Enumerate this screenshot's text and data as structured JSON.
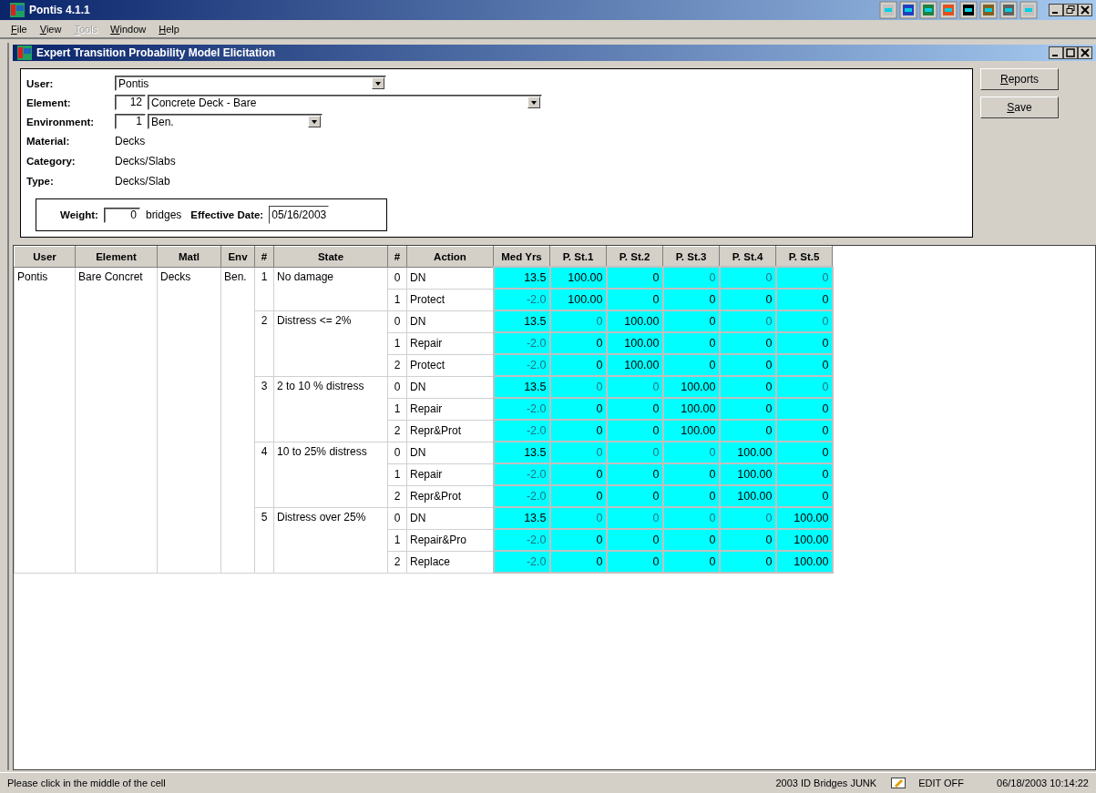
{
  "app": {
    "title": "Pontis 4.1.1"
  },
  "menu": [
    {
      "label": "File",
      "disabled": false
    },
    {
      "label": "View",
      "disabled": false
    },
    {
      "label": "Tools",
      "disabled": true
    },
    {
      "label": "Window",
      "disabled": false
    },
    {
      "label": "Help",
      "disabled": false
    }
  ],
  "child_window": {
    "title": "Expert Transition Probability Model Elicitation"
  },
  "form": {
    "user": {
      "label": "User:",
      "value": "Pontis"
    },
    "element": {
      "label": "Element:",
      "code": "12",
      "value": "Concrete Deck - Bare"
    },
    "environment": {
      "label": "Environment:",
      "code": "1",
      "value": "Ben."
    },
    "info": [
      {
        "label": "Material:",
        "value": "Decks"
      },
      {
        "label": "Category:",
        "value": "Decks/Slabs"
      },
      {
        "label": "Type:",
        "value": "Decks/Slab"
      }
    ],
    "weight": {
      "label": "Weight:",
      "value": "0",
      "unit": "bridges"
    },
    "effective_date": {
      "label": "Effective Date:",
      "value": "05/16/2003"
    }
  },
  "buttons": [
    "Reports",
    "Save"
  ],
  "grid": {
    "columns": [
      "User",
      "Element",
      "Matl",
      "Env",
      "#",
      "State",
      "#",
      "Action",
      "Med Yrs",
      "P. St.1",
      "P. St.2",
      "P. St.3",
      "P. St.4",
      "P. St.5"
    ],
    "user": "Pontis",
    "element": "Bare Concret",
    "matl": "Decks",
    "env": "Ben.",
    "states": [
      {
        "num": "1",
        "name": "No damage",
        "actions": [
          {
            "num": "0",
            "name": "DN",
            "med_yrs": {
              "text": "13.5",
              "dim": false
            },
            "probs": [
              {
                "text": "100.00",
                "dim": false
              },
              {
                "text": "0",
                "dim": false
              },
              {
                "text": "0",
                "dim": true
              },
              {
                "text": "0",
                "dim": true
              },
              {
                "text": "0",
                "dim": true
              }
            ]
          },
          {
            "num": "1",
            "name": "Protect",
            "med_yrs": {
              "text": "-2.0",
              "dim": true
            },
            "probs": [
              {
                "text": "100.00",
                "dim": false
              },
              {
                "text": "0",
                "dim": false
              },
              {
                "text": "0",
                "dim": false
              },
              {
                "text": "0",
                "dim": false
              },
              {
                "text": "0",
                "dim": false
              }
            ]
          }
        ]
      },
      {
        "num": "2",
        "name": "Distress <= 2%",
        "actions": [
          {
            "num": "0",
            "name": "DN",
            "med_yrs": {
              "text": "13.5",
              "dim": false
            },
            "probs": [
              {
                "text": "0",
                "dim": true
              },
              {
                "text": "100.00",
                "dim": false
              },
              {
                "text": "0",
                "dim": false
              },
              {
                "text": "0",
                "dim": true
              },
              {
                "text": "0",
                "dim": true
              }
            ]
          },
          {
            "num": "1",
            "name": "Repair",
            "med_yrs": {
              "text": "-2.0",
              "dim": true
            },
            "probs": [
              {
                "text": "0",
                "dim": false
              },
              {
                "text": "100.00",
                "dim": false
              },
              {
                "text": "0",
                "dim": false
              },
              {
                "text": "0",
                "dim": false
              },
              {
                "text": "0",
                "dim": false
              }
            ]
          },
          {
            "num": "2",
            "name": "Protect",
            "med_yrs": {
              "text": "-2.0",
              "dim": true
            },
            "probs": [
              {
                "text": "0",
                "dim": false
              },
              {
                "text": "100.00",
                "dim": false
              },
              {
                "text": "0",
                "dim": false
              },
              {
                "text": "0",
                "dim": false
              },
              {
                "text": "0",
                "dim": false
              }
            ]
          }
        ]
      },
      {
        "num": "3",
        "name": "2 to 10 % distress",
        "actions": [
          {
            "num": "0",
            "name": "DN",
            "med_yrs": {
              "text": "13.5",
              "dim": false
            },
            "probs": [
              {
                "text": "0",
                "dim": true
              },
              {
                "text": "0",
                "dim": true
              },
              {
                "text": "100.00",
                "dim": false
              },
              {
                "text": "0",
                "dim": false
              },
              {
                "text": "0",
                "dim": true
              }
            ]
          },
          {
            "num": "1",
            "name": "Repair",
            "med_yrs": {
              "text": "-2.0",
              "dim": true
            },
            "probs": [
              {
                "text": "0",
                "dim": false
              },
              {
                "text": "0",
                "dim": false
              },
              {
                "text": "100.00",
                "dim": false
              },
              {
                "text": "0",
                "dim": false
              },
              {
                "text": "0",
                "dim": false
              }
            ]
          },
          {
            "num": "2",
            "name": "Repr&Prot",
            "med_yrs": {
              "text": "-2.0",
              "dim": true
            },
            "probs": [
              {
                "text": "0",
                "dim": false
              },
              {
                "text": "0",
                "dim": false
              },
              {
                "text": "100.00",
                "dim": false
              },
              {
                "text": "0",
                "dim": false
              },
              {
                "text": "0",
                "dim": false
              }
            ]
          }
        ]
      },
      {
        "num": "4",
        "name": "10 to 25% distress",
        "actions": [
          {
            "num": "0",
            "name": "DN",
            "med_yrs": {
              "text": "13.5",
              "dim": false
            },
            "probs": [
              {
                "text": "0",
                "dim": true
              },
              {
                "text": "0",
                "dim": true
              },
              {
                "text": "0",
                "dim": true
              },
              {
                "text": "100.00",
                "dim": false
              },
              {
                "text": "0",
                "dim": false
              }
            ]
          },
          {
            "num": "1",
            "name": "Repair",
            "med_yrs": {
              "text": "-2.0",
              "dim": true
            },
            "probs": [
              {
                "text": "0",
                "dim": false
              },
              {
                "text": "0",
                "dim": false
              },
              {
                "text": "0",
                "dim": false
              },
              {
                "text": "100.00",
                "dim": false
              },
              {
                "text": "0",
                "dim": false
              }
            ]
          },
          {
            "num": "2",
            "name": "Repr&Prot",
            "med_yrs": {
              "text": "-2.0",
              "dim": true
            },
            "probs": [
              {
                "text": "0",
                "dim": false
              },
              {
                "text": "0",
                "dim": false
              },
              {
                "text": "0",
                "dim": false
              },
              {
                "text": "100.00",
                "dim": false
              },
              {
                "text": "0",
                "dim": false
              }
            ]
          }
        ]
      },
      {
        "num": "5",
        "name": "Distress over 25%",
        "actions": [
          {
            "num": "0",
            "name": "DN",
            "med_yrs": {
              "text": "13.5",
              "dim": false
            },
            "probs": [
              {
                "text": "0",
                "dim": true
              },
              {
                "text": "0",
                "dim": true
              },
              {
                "text": "0",
                "dim": true
              },
              {
                "text": "0",
                "dim": true
              },
              {
                "text": "100.00",
                "dim": false
              }
            ]
          },
          {
            "num": "1",
            "name": "Repair&Pro",
            "med_yrs": {
              "text": "-2.0",
              "dim": true
            },
            "probs": [
              {
                "text": "0",
                "dim": false
              },
              {
                "text": "0",
                "dim": false
              },
              {
                "text": "0",
                "dim": false
              },
              {
                "text": "0",
                "dim": false
              },
              {
                "text": "100.00",
                "dim": false
              }
            ]
          },
          {
            "num": "2",
            "name": "Replace",
            "med_yrs": {
              "text": "-2.0",
              "dim": true
            },
            "probs": [
              {
                "text": "0",
                "dim": false
              },
              {
                "text": "0",
                "dim": false
              },
              {
                "text": "0",
                "dim": false
              },
              {
                "text": "0",
                "dim": false
              },
              {
                "text": "100.00",
                "dim": false
              }
            ]
          }
        ]
      }
    ]
  },
  "status_bar": {
    "message": "Please click in the middle of the cell",
    "database": "2003 ID Bridges JUNK",
    "edit_mode": "EDIT OFF",
    "datetime": "06/18/2003 10:14:22"
  }
}
